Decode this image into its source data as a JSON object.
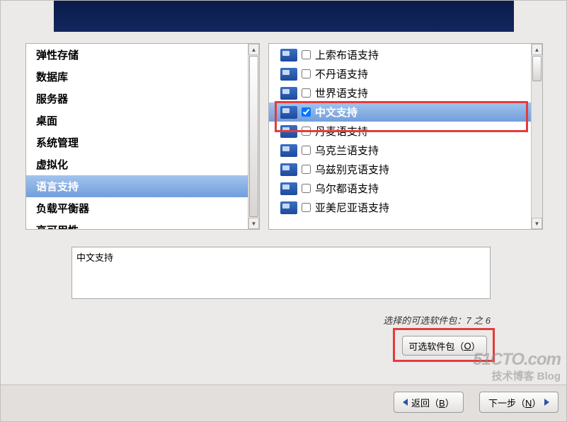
{
  "categories": [
    {
      "label": "弹性存储",
      "selected": false
    },
    {
      "label": "数据库",
      "selected": false
    },
    {
      "label": "服务器",
      "selected": false
    },
    {
      "label": "桌面",
      "selected": false
    },
    {
      "label": "系统管理",
      "selected": false
    },
    {
      "label": "虚拟化",
      "selected": false
    },
    {
      "label": "语言支持",
      "selected": true
    },
    {
      "label": "负载平衡器",
      "selected": false
    },
    {
      "label": "高可用性",
      "selected": false
    }
  ],
  "languages": [
    {
      "label": "上索布语支持",
      "checked": false,
      "selected": false
    },
    {
      "label": "不丹语支持",
      "checked": false,
      "selected": false
    },
    {
      "label": "世界语支持",
      "checked": false,
      "selected": false
    },
    {
      "label": "中文支持",
      "checked": true,
      "selected": true
    },
    {
      "label": "丹麦语支持",
      "checked": false,
      "selected": false
    },
    {
      "label": "乌克兰语支持",
      "checked": false,
      "selected": false
    },
    {
      "label": "乌兹别克语支持",
      "checked": false,
      "selected": false
    },
    {
      "label": "乌尔都语支持",
      "checked": false,
      "selected": false
    },
    {
      "label": "亚美尼亚语支持",
      "checked": false,
      "selected": false
    }
  ],
  "description": "中文支持",
  "pkg_count": {
    "prefix": "选择的可选软件包：",
    "value": "7 之 6"
  },
  "buttons": {
    "optional_prefix": "可选软件包（",
    "optional_key": "O",
    "optional_suffix": "）",
    "back_prefix": "返回（",
    "back_key": "B",
    "back_suffix": "）",
    "next_prefix": "下一步（",
    "next_key": "N",
    "next_suffix": "）"
  },
  "watermark": {
    "line1": "51CTO.com",
    "line2": "技术博客  Blog"
  }
}
